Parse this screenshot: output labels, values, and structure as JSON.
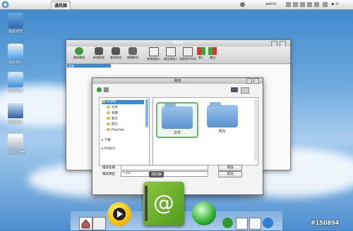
{
  "topbar": {
    "app_title": "通訊錄",
    "user": "admin",
    "clock": "▶ ⊙"
  },
  "desktop": [
    {
      "label": "檔案總管",
      "icon": "file-manager-icon"
    },
    {
      "label": "我的相片",
      "icon": "photos-icon"
    },
    {
      "label": "我的音樂",
      "icon": "music-icon"
    },
    {
      "label": "我的影片",
      "icon": "videos-icon"
    },
    {
      "label": "資源回收筒",
      "icon": "recycle-bin-icon"
    }
  ],
  "main_window": {
    "title": "通訊錄",
    "toolbar": [
      {
        "label": "重新整理",
        "icon": "refresh-icon"
      },
      {
        "label": "新增群組",
        "icon": "add-group-icon"
      },
      {
        "label": "刪除群組",
        "icon": "delete-group-icon"
      },
      {
        "label": "編輯群組",
        "icon": "edit-group-icon"
      },
      {
        "label": "新增連絡人",
        "icon": "add-contact-icon"
      },
      {
        "label": "刪除連絡人",
        "icon": "delete-contact-icon"
      },
      {
        "label": "設群組中所有",
        "icon": "set-group-icon"
      },
      {
        "label": "匯入",
        "icon": "import-icon"
      },
      {
        "label": "匯出",
        "icon": "export-icon"
      }
    ],
    "tree_selected": "全部"
  },
  "dialog": {
    "title": "開啟",
    "sidebar": [
      {
        "label": "HOME",
        "level": 0,
        "selected": true
      },
      {
        "label": "文件",
        "level": 1
      },
      {
        "label": "音樂",
        "level": 1
      },
      {
        "label": "影片",
        "level": 1
      },
      {
        "label": "照片",
        "level": 1
      },
      {
        "label": "Playlists",
        "level": 1
      },
      {
        "label": "下載",
        "level": 0
      },
      {
        "label": "PUBLIC",
        "level": 0
      }
    ],
    "folders": [
      {
        "label": "文件",
        "selected": true
      },
      {
        "label": "照片",
        "selected": false
      }
    ],
    "filename_label": "檔案名稱",
    "filename_value": "",
    "filetype_label": "檔案類型",
    "filetype_value": "*.csv",
    "open_button": "開啟",
    "cancel_button": "取消"
  },
  "tooltip": "通訊錄",
  "watermark": "#150894",
  "dock": [
    {
      "name": "home-icon"
    },
    {
      "name": "window-switch-icon"
    },
    {
      "name": "media-player-icon"
    },
    {
      "name": "address-book-icon"
    },
    {
      "name": "browser-icon"
    },
    {
      "name": "sync-icon"
    },
    {
      "name": "notes-icon"
    },
    {
      "name": "settings-icon"
    },
    {
      "name": "globe-small-icon"
    }
  ]
}
